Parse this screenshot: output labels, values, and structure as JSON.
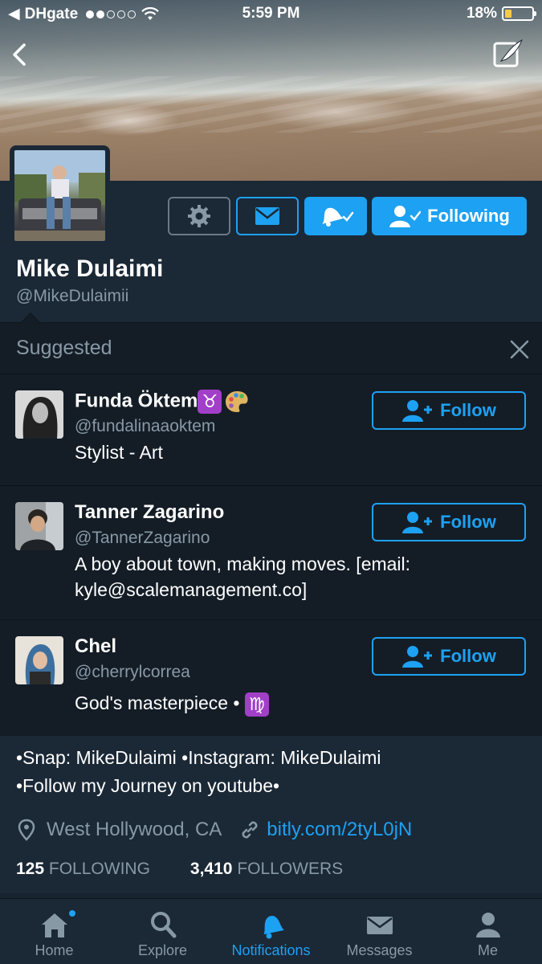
{
  "status_bar": {
    "carrier": "DHgate",
    "time": "5:59 PM",
    "battery": "18%"
  },
  "profile": {
    "name": "Mike Dulaimi",
    "handle": "@MikeDulaimii",
    "following_label": "Following",
    "bio_line1": "•Snap: MikeDulaimi •Instagram: MikeDulaimi",
    "bio_line2": "•Follow my Journey on youtube•",
    "location": "West Hollywood, CA",
    "link": "bitly.com/2tyL0jN",
    "following_count": "125",
    "following_text": "FOLLOWING",
    "followers_count": "3,410",
    "followers_text": "FOLLOWERS"
  },
  "suggested": {
    "title": "Suggested",
    "follow_label": "Follow",
    "items": [
      {
        "name": "Funda Öktem",
        "name_emoji": "♉",
        "handle": "@fundalinaaoktem",
        "bio": "Stylist - Art"
      },
      {
        "name": "Tanner Zagarino",
        "handle": "@TannerZagarino",
        "bio": "A boy about town, making moves. [email: kyle@scalemanagement.co]"
      },
      {
        "name": "Chel",
        "handle": "@cherrylcorrea",
        "bio": "God's masterpiece •",
        "bio_emoji": "♍"
      }
    ]
  },
  "tabs": [
    {
      "label": "Home",
      "icon": "home-icon"
    },
    {
      "label": "Explore",
      "icon": "search-icon"
    },
    {
      "label": "Notifications",
      "icon": "bell-icon"
    },
    {
      "label": "Messages",
      "icon": "envelope-icon"
    },
    {
      "label": "Me",
      "icon": "person-icon"
    }
  ],
  "colors": {
    "accent": "#1da1f2",
    "background": "#1b2836",
    "suggested_bg": "#141d26",
    "muted_text": "#8899a6"
  }
}
